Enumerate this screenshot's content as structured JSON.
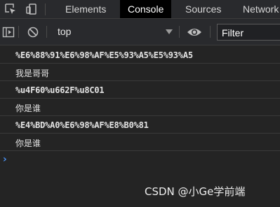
{
  "devtools": {
    "tabs": [
      {
        "label": "Elements",
        "active": false
      },
      {
        "label": "Console",
        "active": true
      },
      {
        "label": "Sources",
        "active": false
      },
      {
        "label": "Network",
        "active": false
      }
    ],
    "toolbar": {
      "context": "top",
      "filter_placeholder": "Filter"
    },
    "console": {
      "messages": [
        {
          "text": "%E6%88%91%E6%98%AF%E5%93%A5%E5%93%A5"
        },
        {
          "text": "我是哥哥"
        },
        {
          "text": "%u4F60%u662F%u8C01"
        },
        {
          "text": "你是谁"
        },
        {
          "text": "%E4%BD%A0%E6%98%AF%E8%B0%81"
        },
        {
          "text": "你是谁"
        }
      ],
      "prompt": "›"
    },
    "watermark": "CSDN @小Ge学前端",
    "icons": [
      "inspect-element-icon",
      "device-toolbar-icon",
      "sidebar-toggle-icon",
      "clear-console-icon",
      "live-expression-eye-icon"
    ],
    "colors": {
      "background": "#242424",
      "active_tab": "#000000",
      "prompt": "#4a8ff0"
    }
  }
}
